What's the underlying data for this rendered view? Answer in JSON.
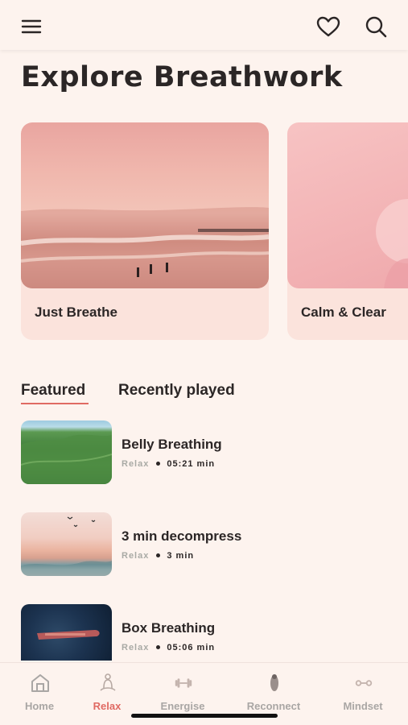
{
  "header": {
    "menu_icon": "hamburger-menu-icon",
    "favorites_icon": "heart-icon",
    "search_icon": "search-icon"
  },
  "page": {
    "title": "Explore Breathwork"
  },
  "carousel": {
    "cards": [
      {
        "label": "Just Breathe",
        "image": "beach-surfers-sunset"
      },
      {
        "label": "Calm & Clear",
        "image": "pink-abstract"
      }
    ]
  },
  "tabs": [
    {
      "label": "Featured",
      "active": true
    },
    {
      "label": "Recently played",
      "active": false
    }
  ],
  "sessions": [
    {
      "title": "Belly Breathing",
      "category": "Relax",
      "duration": "05:21 min",
      "image": "green-hills"
    },
    {
      "title": "3 min decompress",
      "category": "Relax",
      "duration": "3 min",
      "image": "sea-birds-sunset"
    },
    {
      "title": "Box Breathing",
      "category": "Relax",
      "duration": "05:06 min",
      "image": "boat-aerial-ocean"
    }
  ],
  "bottom_nav": [
    {
      "label": "Home",
      "icon": "home-icon",
      "active": false
    },
    {
      "label": "Relax",
      "icon": "meditation-icon",
      "active": true
    },
    {
      "label": "Energise",
      "icon": "dumbbell-icon",
      "active": false
    },
    {
      "label": "Reconnect",
      "icon": "figure-icon",
      "active": false
    },
    {
      "label": "Mindset",
      "icon": "chain-icon",
      "active": false
    }
  ],
  "colors": {
    "background": "#fdf3ee",
    "accent": "#e06a63",
    "card_bg": "#fbe3dc",
    "text": "#2b2626",
    "muted": "#a9aaa5"
  }
}
